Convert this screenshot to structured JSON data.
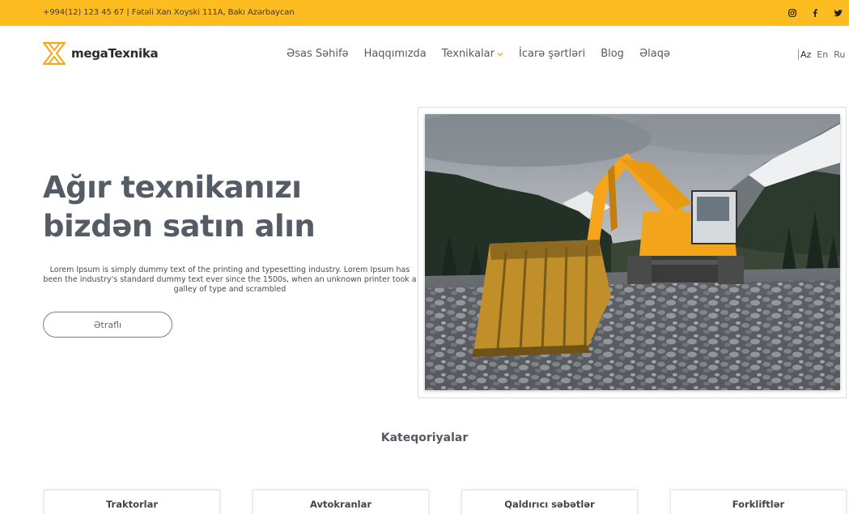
{
  "topbar": {
    "contact": "+994(12) 123 45 67 | Fətəli Xan Xoyski 111A, Bakı Azərbaycan",
    "socials": [
      {
        "icon": "instagram-icon"
      },
      {
        "icon": "facebook-icon"
      },
      {
        "icon": "twitter-icon"
      }
    ],
    "background": "#fdbd20"
  },
  "header": {
    "logo_text": "megaTexnika",
    "nav": [
      {
        "label": "Əsas Səhifə"
      },
      {
        "label": "Haqqımızda"
      },
      {
        "label": "Texnikalar",
        "icon": "chevron-down-icon"
      },
      {
        "label": "İcarə şərtləri"
      },
      {
        "label": "Blog"
      },
      {
        "label": "Əlaqə"
      }
    ],
    "languages": [
      "Az",
      "En",
      "Ru"
    ],
    "active_language": "Az"
  },
  "hero": {
    "title": "Ağır texnikanızı bizdən satın alın",
    "text": "Lorem Ipsum is simply dummy text of the printing and typesetting industry. Lorem Ipsum has been the industry's standard dummy text ever since the 1500s, when an unknown printer took a galley of type and scrambled",
    "button": "Ətraflı"
  },
  "categories": {
    "title": "Kateqoriyalar",
    "items": [
      "Traktorlar",
      "Avtokranlar",
      "Qaldırıcı səbətlər",
      "Forkliftlər"
    ]
  },
  "colors": {
    "accent": "#fdbd20",
    "heading": "#555c66"
  }
}
